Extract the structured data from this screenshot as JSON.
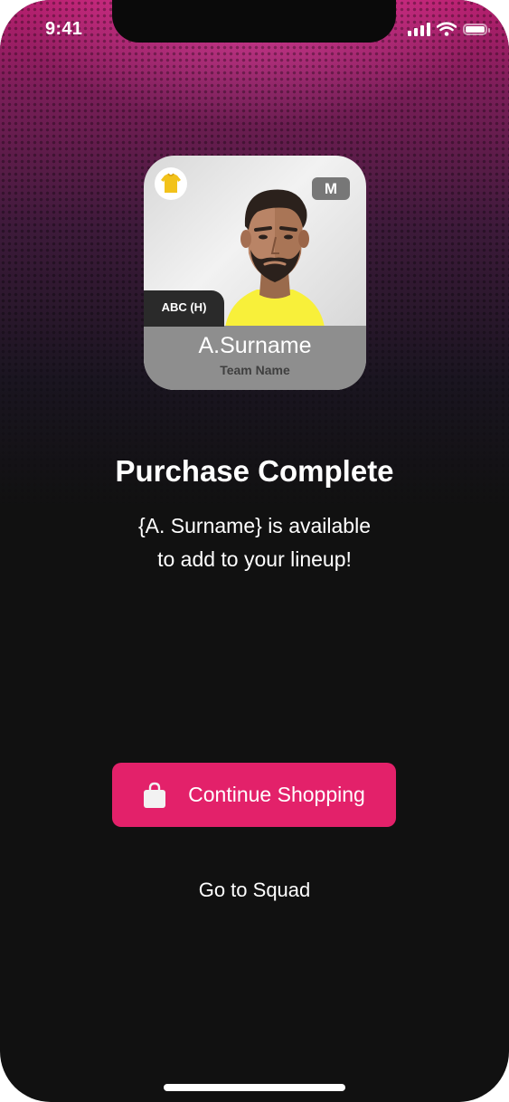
{
  "status_bar": {
    "time": "9:41"
  },
  "player_card": {
    "position_badge": "M",
    "fixture_tag": "ABC (H)",
    "player_name": "A.Surname",
    "team_name": "Team Name"
  },
  "message": {
    "title": "Purchase Complete",
    "line1": "{A. Surname} is available",
    "line2": "to add to your lineup!"
  },
  "actions": {
    "continue_label": "Continue Shopping",
    "squad_label": "Go to Squad"
  },
  "colors": {
    "accent": "#e3216a",
    "background": "#111111",
    "header_gradient_top": "#b81f6f",
    "jersey": "#f8f03a"
  }
}
